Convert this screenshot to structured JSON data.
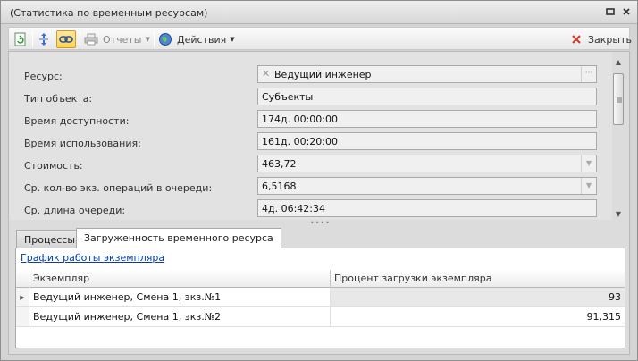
{
  "window": {
    "title": "(Статистика по временным ресурсам)"
  },
  "toolbar": {
    "reports_label": "Отчеты",
    "actions_label": "Действия",
    "close_label": "Закрыть"
  },
  "form": {
    "rows": [
      {
        "label": "Ресурс:",
        "value": "Ведущий инженер"
      },
      {
        "label": "Тип объекта:",
        "value": "Субъекты"
      },
      {
        "label": "Время доступности:",
        "value": "174д. 00:00:00"
      },
      {
        "label": "Время использования:",
        "value": "161д. 00:20:00"
      },
      {
        "label": "Стоимость:",
        "value": "463,72"
      },
      {
        "label": "Ср. кол-во экз. операций в очереди:",
        "value": "6,5168"
      },
      {
        "label": "Ср. длина очереди:",
        "value": "4д. 06:42:34"
      }
    ]
  },
  "tabs": [
    {
      "label": "Процессы"
    },
    {
      "label": "Загруженность временного ресурса"
    }
  ],
  "panel": {
    "link": "График работы экземпляра",
    "grid": {
      "columns": [
        "Экземпляр",
        "Процент загрузки экземпляра"
      ],
      "rows": [
        {
          "instance": "Ведущий инженер, Смена 1, экз.№1",
          "percent": "93"
        },
        {
          "instance": "Ведущий инженер, Смена 1, экз.№2",
          "percent": "91,315"
        }
      ]
    }
  }
}
